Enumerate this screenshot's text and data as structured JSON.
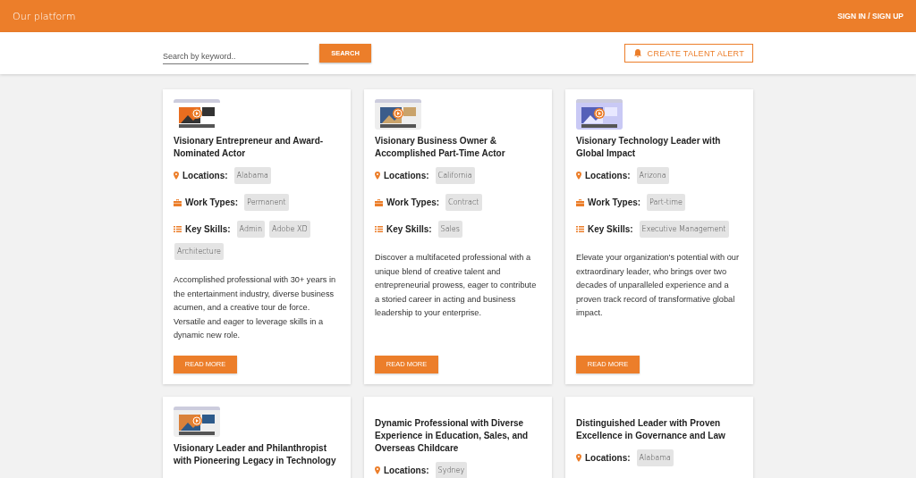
{
  "header": {
    "brand": "Our platform",
    "auth_link": "SIGN IN / SIGN UP"
  },
  "search": {
    "placeholder": "Search by keyword..",
    "button": "SEARCH",
    "alert_button": "CREATE TALENT ALERT"
  },
  "cards": [
    {
      "kind": "video",
      "title": "Visionary Entrepreneur and Award-Nominated Actor",
      "fields": [
        {
          "kind": "location",
          "label": "Locations:",
          "tags": [
            "Alabama"
          ]
        },
        {
          "kind": "work",
          "label": "Work Types:",
          "tags": [
            "Permanent"
          ]
        },
        {
          "kind": "skills",
          "label": "Key Skills:",
          "tags": [
            "Admin",
            "Adobe XD",
            "Architecture"
          ]
        }
      ],
      "description": "Accomplished professional with 30+ years in the entertainment industry, diverse business acumen, and a creative tour de force. Versatile and eager to leverage skills in a dynamic new role.",
      "button": "READ MORE"
    },
    {
      "kind": "video",
      "title": "Visionary Business Owner & Accomplished Part-Time Actor",
      "fields": [
        {
          "kind": "location",
          "label": "Locations:",
          "tags": [
            "California"
          ]
        },
        {
          "kind": "work",
          "label": "Work Types:",
          "tags": [
            "Contract"
          ]
        },
        {
          "kind": "skills",
          "label": "Key Skills:",
          "tags": [
            "Sales"
          ]
        }
      ],
      "description": "Discover a multifaceted professional with a unique blend of creative talent and entrepreneurial prowess, eager to contribute a storied career in acting and business leadership to your enterprise.",
      "button": "READ MORE"
    },
    {
      "kind": "video",
      "title": "Visionary Technology Leader with Global Impact",
      "fields": [
        {
          "kind": "location",
          "label": "Locations:",
          "tags": [
            "Arizona"
          ]
        },
        {
          "kind": "work",
          "label": "Work Types:",
          "tags": [
            "Part-time"
          ]
        },
        {
          "kind": "skills",
          "label": "Key Skills:",
          "tags": [
            "Executive Management"
          ]
        }
      ],
      "description": "Elevate your organization's potential with our extraordinary leader, who brings over two decades of unparalleled experience and a proven track record of transformative global impact.",
      "button": "READ MORE"
    },
    {
      "kind": "video",
      "title": "Visionary Leader and Philanthropist with Pioneering Legacy in Technology"
    },
    {
      "kind": "plain",
      "title": "Dynamic Professional with Diverse Experience in Education, Sales, and Overseas Childcare",
      "fields": [
        {
          "kind": "location",
          "label": "Locations:",
          "tags": [
            "Sydney"
          ]
        }
      ]
    },
    {
      "kind": "plain",
      "title": "Distinguished Leader with Proven Excellence in Governance and Law",
      "fields": [
        {
          "kind": "location",
          "label": "Locations:",
          "tags": [
            "Alabama"
          ]
        }
      ]
    }
  ]
}
